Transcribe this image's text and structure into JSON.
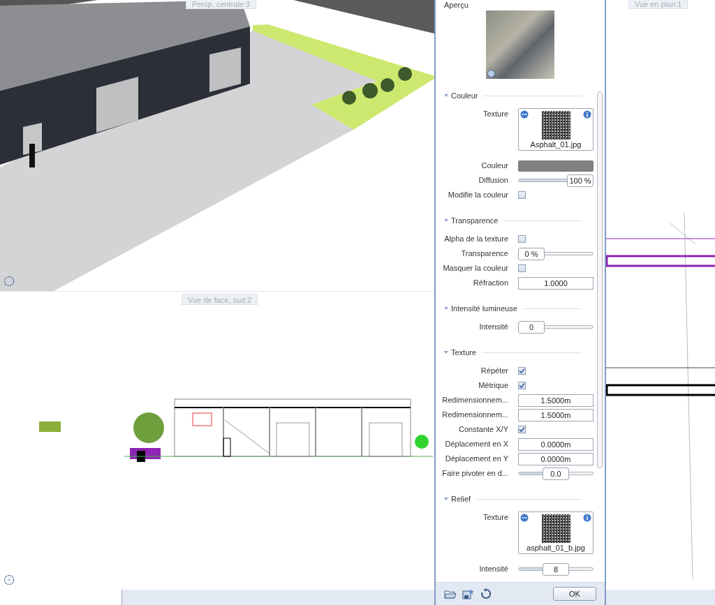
{
  "viewports": [
    {
      "label": "Persp. centrale:3"
    },
    {
      "label": "Vue de face, sud:2"
    },
    {
      "label": "Vue en plan:1"
    }
  ],
  "panel": {
    "preview_title": "Aperçu",
    "sections": [
      {
        "title": "Couleur",
        "expanded": true,
        "rows": [
          {
            "kind": "texture",
            "label": "Texture",
            "file": "Asphalt_01.jpg"
          },
          {
            "kind": "color",
            "label": "Couleur",
            "color": "#808080"
          },
          {
            "kind": "slider",
            "label": "Diffusion",
            "value": "100 %",
            "level": 1
          },
          {
            "kind": "checkbox",
            "label": "Modifie la couleur",
            "checked": false
          }
        ]
      },
      {
        "title": "Transparence",
        "expanded": true,
        "rows": [
          {
            "kind": "checkbox",
            "label": "Alpha de la texture",
            "checked": false
          },
          {
            "kind": "slider",
            "label": "Transparence",
            "value": "0 %",
            "level": 0
          },
          {
            "kind": "checkbox",
            "label": "Masquer la couleur",
            "checked": false
          },
          {
            "kind": "input",
            "label": "Réfraction",
            "value": "1.0000"
          }
        ]
      },
      {
        "title": "Intensité lumineuse",
        "expanded": true,
        "rows": [
          {
            "kind": "slider",
            "label": "Intensité",
            "value": "0",
            "level": 0
          }
        ]
      },
      {
        "title": "Texture",
        "expanded": true,
        "rows": [
          {
            "kind": "checkbox",
            "label": "Répéter",
            "checked": true
          },
          {
            "kind": "checkbox",
            "label": "Métrique",
            "checked": true
          },
          {
            "kind": "input",
            "label": "Redimensionnem...",
            "value": "1.5000m"
          },
          {
            "kind": "input",
            "label": "Redimensionnem...",
            "value": "1.5000m"
          },
          {
            "kind": "checkbox",
            "label": "Constante X/Y",
            "checked": true
          },
          {
            "kind": "input",
            "label": "Déplacement en X",
            "value": "0.0000m"
          },
          {
            "kind": "input",
            "label": "Déplacement en Y",
            "value": "0.0000m"
          },
          {
            "kind": "slider",
            "label": "Faire pivoter en d...",
            "value": "0.0",
            "level": 0.5
          }
        ]
      },
      {
        "title": "Relief",
        "expanded": true,
        "rows": [
          {
            "kind": "texture",
            "label": "Texture",
            "file": "asphalt_01_b.jpg"
          },
          {
            "kind": "slider",
            "label": "Intensité",
            "value": "8",
            "level": 0.5
          }
        ]
      }
    ],
    "ok_button": "OK"
  }
}
